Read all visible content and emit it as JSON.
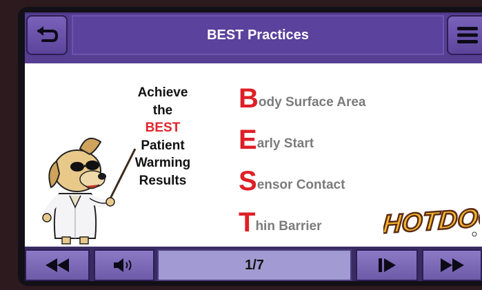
{
  "header": {
    "title": "BEST Practices"
  },
  "intro": {
    "line1": "Achieve",
    "line2": "the",
    "line3": "BEST",
    "line4": "Patient",
    "line5": "Warming",
    "line6": "Results"
  },
  "acrostic": [
    {
      "letter": "B",
      "rest": "ody Surface Area"
    },
    {
      "letter": "E",
      "rest": "arly Start"
    },
    {
      "letter": "S",
      "rest": "ensor Contact"
    },
    {
      "letter": "T",
      "rest": "hin Barrier"
    }
  ],
  "footer": {
    "page": "1/7"
  },
  "logo": {
    "text": "HOTDOG"
  },
  "colors": {
    "header_purple": "#563e92",
    "accent_red": "#df1f26",
    "text_gray": "#7b7b7b",
    "page_indicator": "#a29bd3"
  },
  "icons": {
    "back": "back-arrow-icon",
    "menu": "hamburger-menu-icon",
    "rewind": "rewind-icon",
    "volume": "volume-icon",
    "next": "next-page-icon",
    "fast_forward": "fast-forward-icon"
  }
}
